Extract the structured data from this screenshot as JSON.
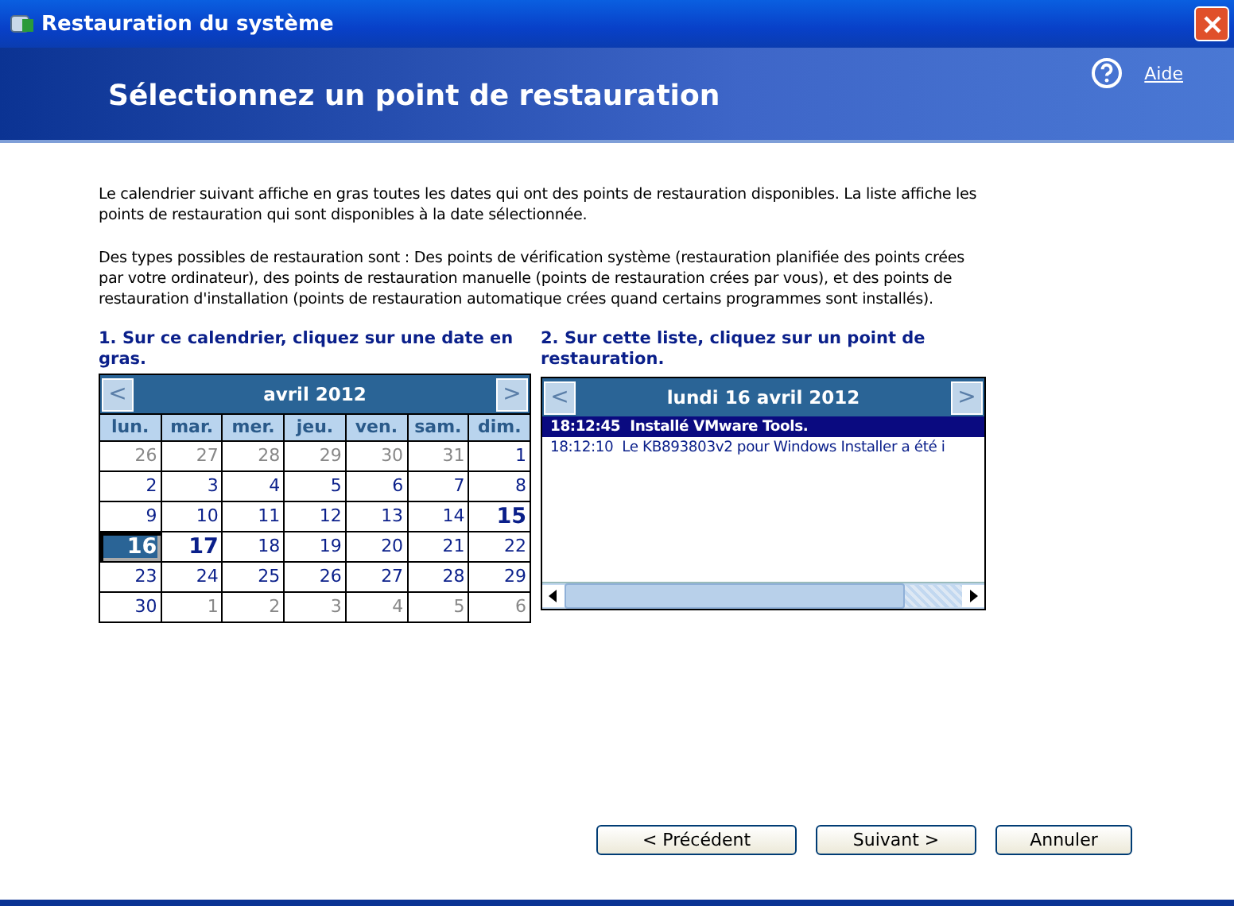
{
  "window": {
    "title": "Restauration du système"
  },
  "header": {
    "title": "Sélectionnez un point de restauration",
    "help_link": "Aide"
  },
  "intro": [
    "Le calendrier suivant affiche en gras toutes les dates qui ont des points de restauration disponibles. La liste affiche les points de restauration qui sont disponibles à la date sélectionnée.",
    "Des types possibles de restauration sont : Des points de vérification système (restauration planifiée des points crées par votre ordinateur), des points de restauration manuelle (points de restauration crées par vous), et des points de restauration d'installation (points de restauration automatique crées quand certains programmes sont installés)."
  ],
  "calendar": {
    "instruction": "1. Sur ce calendrier, cliquez sur une date en gras.",
    "prev": "<",
    "next": ">",
    "month": "avril 2012",
    "weekdays": [
      "lun.",
      "mar.",
      "mer.",
      "jeu.",
      "ven.",
      "sam.",
      "dim."
    ],
    "weeks": [
      [
        {
          "day": "26",
          "other_month": true,
          "bold": false,
          "selected": false
        },
        {
          "day": "27",
          "other_month": true,
          "bold": false,
          "selected": false
        },
        {
          "day": "28",
          "other_month": true,
          "bold": false,
          "selected": false
        },
        {
          "day": "29",
          "other_month": true,
          "bold": false,
          "selected": false
        },
        {
          "day": "30",
          "other_month": true,
          "bold": false,
          "selected": false
        },
        {
          "day": "31",
          "other_month": true,
          "bold": false,
          "selected": false
        },
        {
          "day": "1",
          "other_month": false,
          "bold": false,
          "selected": false
        }
      ],
      [
        {
          "day": "2",
          "other_month": false,
          "bold": false,
          "selected": false
        },
        {
          "day": "3",
          "other_month": false,
          "bold": false,
          "selected": false
        },
        {
          "day": "4",
          "other_month": false,
          "bold": false,
          "selected": false
        },
        {
          "day": "5",
          "other_month": false,
          "bold": false,
          "selected": false
        },
        {
          "day": "6",
          "other_month": false,
          "bold": false,
          "selected": false
        },
        {
          "day": "7",
          "other_month": false,
          "bold": false,
          "selected": false
        },
        {
          "day": "8",
          "other_month": false,
          "bold": false,
          "selected": false
        }
      ],
      [
        {
          "day": "9",
          "other_month": false,
          "bold": false,
          "selected": false
        },
        {
          "day": "10",
          "other_month": false,
          "bold": false,
          "selected": false
        },
        {
          "day": "11",
          "other_month": false,
          "bold": false,
          "selected": false
        },
        {
          "day": "12",
          "other_month": false,
          "bold": false,
          "selected": false
        },
        {
          "day": "13",
          "other_month": false,
          "bold": false,
          "selected": false
        },
        {
          "day": "14",
          "other_month": false,
          "bold": false,
          "selected": false
        },
        {
          "day": "15",
          "other_month": false,
          "bold": true,
          "selected": false
        }
      ],
      [
        {
          "day": "16",
          "other_month": false,
          "bold": true,
          "selected": true
        },
        {
          "day": "17",
          "other_month": false,
          "bold": true,
          "selected": false
        },
        {
          "day": "18",
          "other_month": false,
          "bold": false,
          "selected": false
        },
        {
          "day": "19",
          "other_month": false,
          "bold": false,
          "selected": false
        },
        {
          "day": "20",
          "other_month": false,
          "bold": false,
          "selected": false
        },
        {
          "day": "21",
          "other_month": false,
          "bold": false,
          "selected": false
        },
        {
          "day": "22",
          "other_month": false,
          "bold": false,
          "selected": false
        }
      ],
      [
        {
          "day": "23",
          "other_month": false,
          "bold": false,
          "selected": false
        },
        {
          "day": "24",
          "other_month": false,
          "bold": false,
          "selected": false
        },
        {
          "day": "25",
          "other_month": false,
          "bold": false,
          "selected": false
        },
        {
          "day": "26",
          "other_month": false,
          "bold": false,
          "selected": false
        },
        {
          "day": "27",
          "other_month": false,
          "bold": false,
          "selected": false
        },
        {
          "day": "28",
          "other_month": false,
          "bold": false,
          "selected": false
        },
        {
          "day": "29",
          "other_month": false,
          "bold": false,
          "selected": false
        }
      ],
      [
        {
          "day": "30",
          "other_month": false,
          "bold": false,
          "selected": false
        },
        {
          "day": "1",
          "other_month": true,
          "bold": false,
          "selected": false
        },
        {
          "day": "2",
          "other_month": true,
          "bold": false,
          "selected": false
        },
        {
          "day": "3",
          "other_month": true,
          "bold": false,
          "selected": false
        },
        {
          "day": "4",
          "other_month": true,
          "bold": false,
          "selected": false
        },
        {
          "day": "5",
          "other_month": true,
          "bold": false,
          "selected": false
        },
        {
          "day": "6",
          "other_month": true,
          "bold": false,
          "selected": false
        }
      ]
    ]
  },
  "restore_list": {
    "instruction": "2. Sur cette liste, cliquez sur un point de restauration.",
    "prev": "<",
    "next": ">",
    "date": "lundi 16 avril 2012",
    "items": [
      {
        "time": "18:12:45",
        "description": "Installé VMware Tools.",
        "selected": true
      },
      {
        "time": "18:12:10",
        "description": "Le KB893803v2 pour Windows Installer a été i",
        "selected": false
      }
    ]
  },
  "buttons": [
    {
      "label": "< Précédent"
    },
    {
      "label": "Suivant >"
    },
    {
      "label": "Annuler"
    }
  ]
}
